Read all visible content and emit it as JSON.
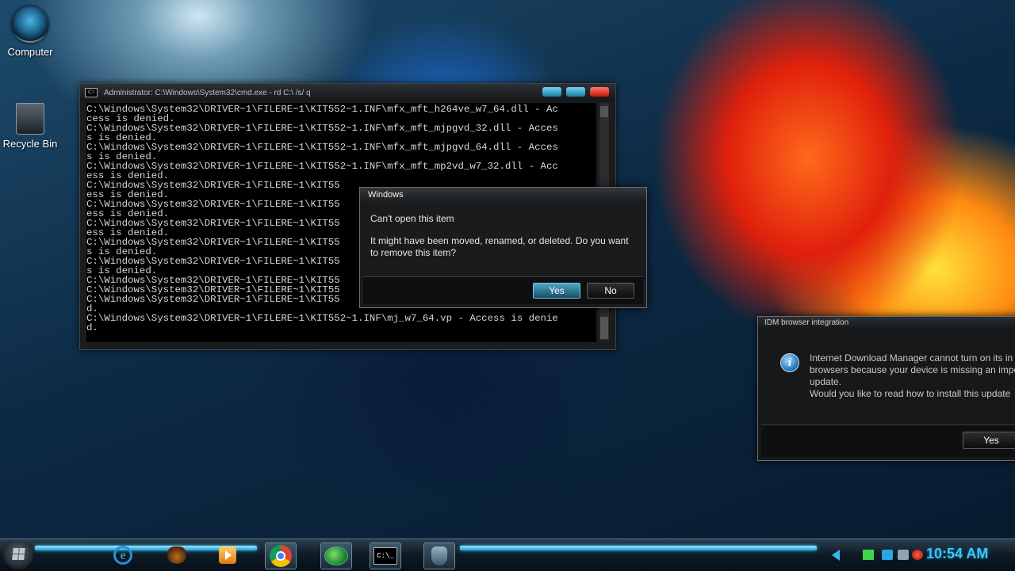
{
  "desktop": {
    "icons": [
      {
        "label": "Computer",
        "icon": "computer-icon"
      },
      {
        "label": "Recycle Bin",
        "icon": "recycle-bin-icon"
      }
    ]
  },
  "cmd_window": {
    "title": "Administrator: C:\\Windows\\System32\\cmd.exe - rd  C:\\ /s/ q",
    "icon_label": "C:\\",
    "lines": [
      "C:\\Windows\\System32\\DRIVER~1\\FILERE~1\\KIT552~1.INF\\mfx_mft_h264ve_w7_64.dll - Ac",
      "cess is denied.",
      "C:\\Windows\\System32\\DRIVER~1\\FILERE~1\\KIT552~1.INF\\mfx_mft_mjpgvd_32.dll - Acces",
      "s is denied.",
      "C:\\Windows\\System32\\DRIVER~1\\FILERE~1\\KIT552~1.INF\\mfx_mft_mjpgvd_64.dll - Acces",
      "s is denied.",
      "C:\\Windows\\System32\\DRIVER~1\\FILERE~1\\KIT552~1.INF\\mfx_mft_mp2vd_w7_32.dll - Acc",
      "ess is denied.",
      "C:\\Windows\\System32\\DRIVER~1\\FILERE~1\\KIT55",
      "ess is denied.",
      "C:\\Windows\\System32\\DRIVER~1\\FILERE~1\\KIT55",
      "ess is denied.",
      "C:\\Windows\\System32\\DRIVER~1\\FILERE~1\\KIT55",
      "ess is denied.",
      "C:\\Windows\\System32\\DRIVER~1\\FILERE~1\\KIT55",
      "s is denied.",
      "C:\\Windows\\System32\\DRIVER~1\\FILERE~1\\KIT55",
      "s is denied.",
      "C:\\Windows\\System32\\DRIVER~1\\FILERE~1\\KIT55",
      "C:\\Windows\\System32\\DRIVER~1\\FILERE~1\\KIT55",
      "C:\\Windows\\System32\\DRIVER~1\\FILERE~1\\KIT55",
      "d.",
      "C:\\Windows\\System32\\DRIVER~1\\FILERE~1\\KIT552~1.INF\\mj_w7_64.vp - Access is denie",
      "d."
    ]
  },
  "windows_dialog": {
    "title": "Windows",
    "message1": "Can't open this item",
    "message2": "It might have been moved, renamed, or deleted. Do you want to remove this item?",
    "yes_label": "Yes",
    "no_label": "No"
  },
  "idm_dialog": {
    "title": "IDM browser integration",
    "lines": [
      "Internet Download Manager cannot turn on its in",
      "browsers because your device is missing an impo",
      "update.",
      "Would you like to read how to install this update"
    ],
    "yes_label": "Yes"
  },
  "taskbar": {
    "items": [
      {
        "name": "internet-explorer",
        "icon": "internet-explorer-icon",
        "glyph": "e"
      },
      {
        "name": "gimp",
        "icon": "gimp-icon"
      },
      {
        "name": "media-player",
        "icon": "media-player-icon"
      },
      {
        "name": "chrome",
        "icon": "chrome-icon"
      },
      {
        "name": "internet-download-manager",
        "icon": "idm-icon"
      },
      {
        "name": "command-prompt",
        "icon": "cmd-icon",
        "glyph": "C:\\_"
      },
      {
        "name": "security",
        "icon": "shield-icon"
      }
    ],
    "clock": "10:54 AM"
  },
  "colors": {
    "accent": "#40c6f5",
    "close_button": "#c2150a"
  }
}
